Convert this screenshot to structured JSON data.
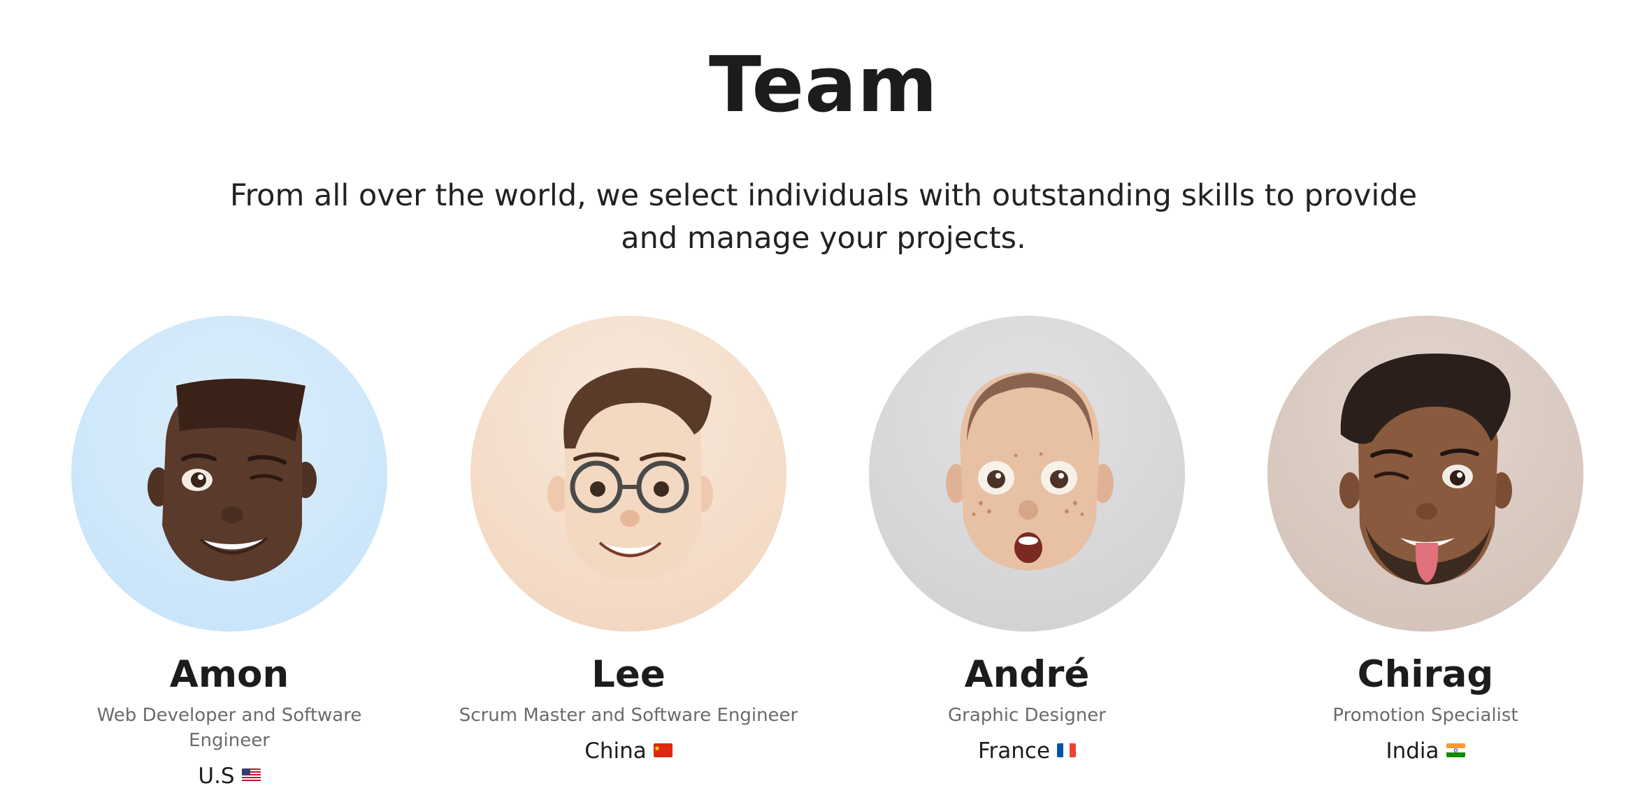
{
  "page": {
    "title": "Team",
    "subtitle": "From all over the world, we select individuals with outstanding skills to provide and manage your projects."
  },
  "members": [
    {
      "name": "Amon",
      "role": "Web Developer and Software Engineer",
      "country": "U.S",
      "flag": "us-flag-icon",
      "bg": "#cfe8fa",
      "skin": "#5a3a2b",
      "hair": "#3b2318"
    },
    {
      "name": "Lee",
      "role": "Scrum Master and Software Engineer",
      "country": "China",
      "flag": "china-flag-icon",
      "bg": "#f4dcc8",
      "skin": "#f3d6bf",
      "hair": "#5a3b2a"
    },
    {
      "name": "André",
      "role": "Graphic Designer",
      "country": "France",
      "flag": "france-flag-icon",
      "bg": "#d8d8da",
      "skin": "#e7bea1",
      "hair": "#7a5440"
    },
    {
      "name": "Chirag",
      "role": "Promotion Specialist",
      "country": "India",
      "flag": "india-flag-icon",
      "bg": "#d9c9c0",
      "skin": "#8a5a3e",
      "hair": "#2a1f1a"
    }
  ]
}
